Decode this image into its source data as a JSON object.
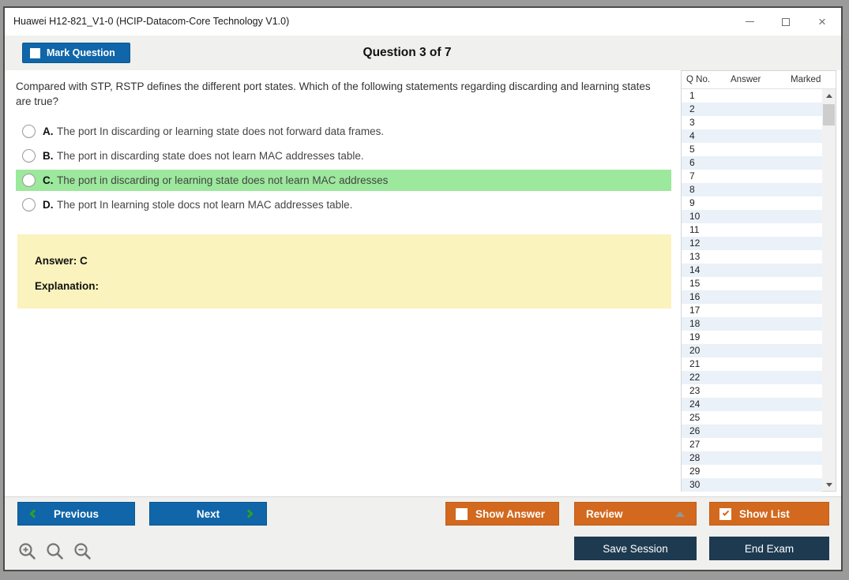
{
  "window": {
    "title": "Huawei H12-821_V1-0 (HCIP-Datacom-Core Technology V1.0)"
  },
  "icons": {
    "close": "×"
  },
  "header": {
    "mark_question": "Mark Question",
    "question_counter": "Question 3 of 7"
  },
  "question": {
    "text": "Compared with STP, RSTP defines the different port states. Which of the following statements regarding discarding and learning states are true?",
    "highlighted_option": "C",
    "options": [
      {
        "letter": "A.",
        "text": "The port In discarding or learning state does not forward data frames."
      },
      {
        "letter": "B.",
        "text": "The port in discarding state does not learn MAC addresses table."
      },
      {
        "letter": "C.",
        "text": "The port in discarding or learning state does not learn MAC addresses"
      },
      {
        "letter": "D.",
        "text": "The port In learning stole docs not learn MAC addresses table."
      }
    ]
  },
  "answer_box": {
    "answer": "Answer: C",
    "explanation": "Explanation:"
  },
  "question_list": {
    "headers": [
      "Q No.",
      "Answer",
      "Marked"
    ],
    "rows": [
      1,
      2,
      3,
      4,
      5,
      6,
      7,
      8,
      9,
      10,
      11,
      12,
      13,
      14,
      15,
      16,
      17,
      18,
      19,
      20,
      21,
      22,
      23,
      24,
      25,
      26,
      27,
      28,
      29,
      30
    ]
  },
  "footer": {
    "previous": "Previous",
    "next": "Next",
    "show_answer": "Show Answer",
    "review": "Review",
    "show_list": "Show List",
    "save_session": "Save Session",
    "end_exam": "End Exam",
    "show_answer_checked": false,
    "show_list_checked": true
  },
  "colors": {
    "accent_blue": "#1066A9",
    "accent_orange": "#D2691E",
    "dark_navy": "#1D3A50",
    "highlight_green": "#9CE89C",
    "answer_yellow": "#FAF3BD",
    "row_alt_blue": "#EAF1F8",
    "band_gray": "#F0F0EE",
    "chevron_green": "#27A327"
  }
}
